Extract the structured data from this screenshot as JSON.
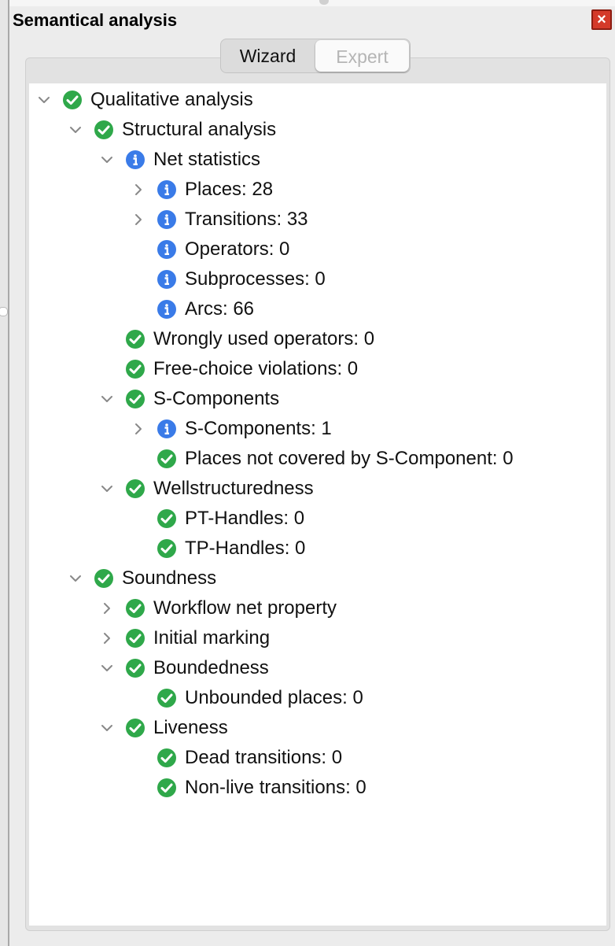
{
  "window": {
    "title": "Semantical analysis"
  },
  "tabs": {
    "wizard": "Wizard",
    "expert": "Expert"
  },
  "icons": {
    "ok": "check-circle-icon",
    "info": "info-circle-icon",
    "close": "close-icon"
  },
  "colors": {
    "ok": "#2fa84a",
    "info": "#3a7be8",
    "close": "#d43a2a"
  },
  "tree": {
    "qualitative": "Qualitative analysis",
    "structural": "Structural analysis",
    "net_statistics": "Net statistics",
    "places": "Places: 28",
    "transitions": "Transitions: 33",
    "operators": "Operators: 0",
    "subprocesses": "Subprocesses: 0",
    "arcs": "Arcs: 66",
    "wrong_operators": "Wrongly used operators: 0",
    "free_choice": "Free-choice violations: 0",
    "s_components_group": "S-Components",
    "s_components": "S-Components: 1",
    "places_not_covered": "Places not covered by S-Component: 0",
    "wellstructuredness": "Wellstructuredness",
    "pt_handles": "PT-Handles: 0",
    "tp_handles": "TP-Handles: 0",
    "soundness": "Soundness",
    "workflow_net": "Workflow net property",
    "initial_marking": "Initial marking",
    "boundedness": "Boundedness",
    "unbounded_places": "Unbounded places: 0",
    "liveness": "Liveness",
    "dead_transitions": "Dead transitions: 0",
    "non_live_transitions": "Non-live transitions: 0"
  }
}
